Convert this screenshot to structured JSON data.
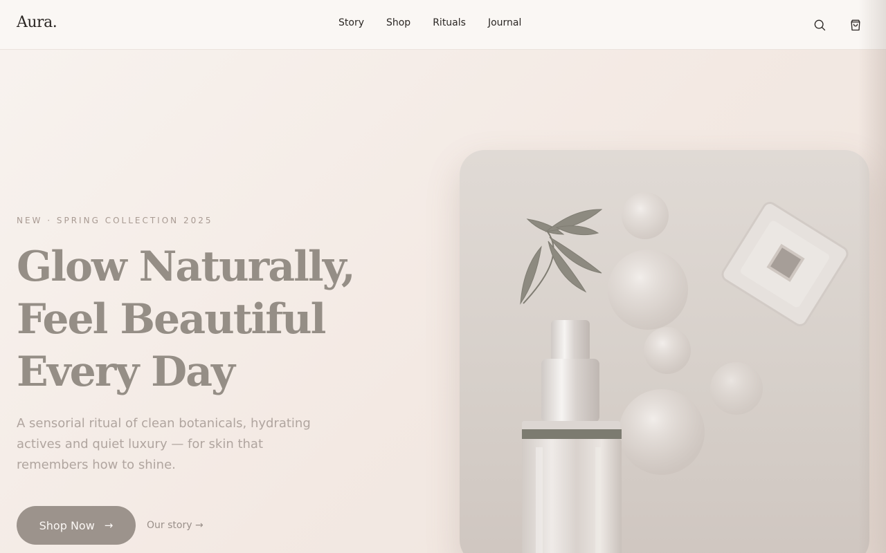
{
  "header": {
    "logo": "Aura.",
    "nav": [
      "Story",
      "Shop",
      "Rituals",
      "Journal"
    ],
    "search_icon": "search-icon",
    "cart_icon": "shopping-bag-icon"
  },
  "hero": {
    "eyebrow": "NEW · SPRING COLLECTION 2025",
    "headline": [
      "Glow Naturally,",
      "Feel Beautiful",
      "Every Day"
    ],
    "subcopy": "A sensorial ritual of clean botanicals, hydrating actives and quiet luxury — for skin that remembers how to shine.",
    "cta_primary": "Shop Now",
    "cta_primary_icon": "arrow-right-icon",
    "cta_secondary": "Our story →"
  },
  "colors": {
    "background": "#f4ebe6",
    "header": "#faf7f4",
    "headline": "#958e86",
    "button": "#9c938c"
  }
}
